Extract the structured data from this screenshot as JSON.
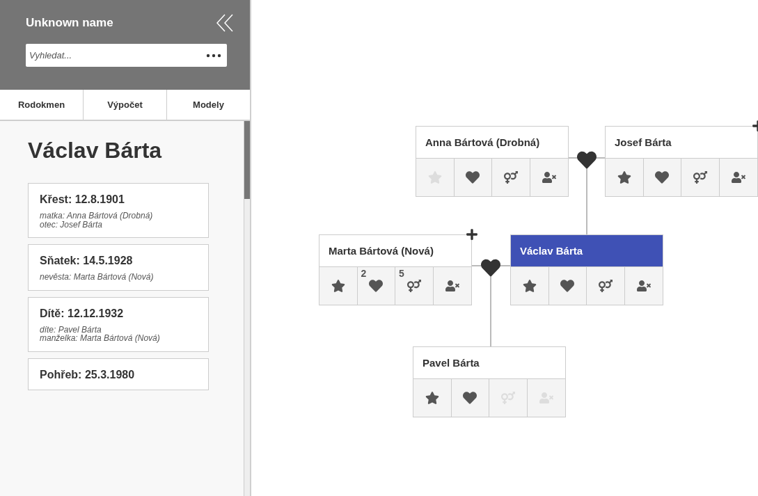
{
  "sidebar": {
    "title": "Unknown name",
    "search": {
      "placeholder": "Vyhledat..."
    },
    "tabs": [
      {
        "label": "Rodokmen",
        "selected": false
      },
      {
        "label": "Výpočet",
        "selected": false
      },
      {
        "label": "Modely",
        "selected": false
      }
    ],
    "person_name": "Václav Bárta",
    "events": [
      {
        "title": "Křest: 12.8.1901",
        "details": [
          "matka: Anna Bártová (Drobná)",
          "otec: Josef Bárta"
        ]
      },
      {
        "title": "Sňatek: 14.5.1928",
        "details": [
          "nevěsta: Marta Bártová (Nová)"
        ]
      },
      {
        "title": "Dítě: 12.12.1932",
        "details": [
          "díte: Pavel Bárta",
          "manželka: Marta Bártová (Nová)"
        ]
      },
      {
        "title": "Pohřeb: 25.3.1980"
      }
    ]
  },
  "tree": {
    "nodes": [
      {
        "name": "Anna Bártová (Drobná)",
        "selected": false,
        "add": false,
        "actions": [
          {
            "kind": "star",
            "disabled": true
          },
          {
            "kind": "heart",
            "disabled": false
          },
          {
            "kind": "gender",
            "disabled": false
          },
          {
            "kind": "remove",
            "disabled": false
          }
        ]
      },
      {
        "name": "Josef Bárta",
        "selected": false,
        "add": true,
        "actions": [
          {
            "kind": "star",
            "disabled": false
          },
          {
            "kind": "heart",
            "disabled": false
          },
          {
            "kind": "gender",
            "disabled": false
          },
          {
            "kind": "remove",
            "disabled": false
          }
        ]
      },
      {
        "name": "Marta Bártová (Nová)",
        "selected": false,
        "add": true,
        "actions": [
          {
            "kind": "star",
            "disabled": false
          },
          {
            "kind": "heart",
            "disabled": false,
            "count": "2"
          },
          {
            "kind": "gender",
            "disabled": false,
            "count": "5"
          },
          {
            "kind": "remove",
            "disabled": false
          }
        ]
      },
      {
        "name": "Václav Bárta",
        "selected": true,
        "add": false,
        "actions": [
          {
            "kind": "star",
            "disabled": false
          },
          {
            "kind": "heart",
            "disabled": false
          },
          {
            "kind": "gender",
            "disabled": false
          },
          {
            "kind": "remove",
            "disabled": false
          }
        ]
      },
      {
        "name": "Pavel Bárta",
        "selected": false,
        "add": false,
        "actions": [
          {
            "kind": "star",
            "disabled": false
          },
          {
            "kind": "heart",
            "disabled": false
          },
          {
            "kind": "gender",
            "disabled": true
          },
          {
            "kind": "remove",
            "disabled": true
          }
        ]
      }
    ]
  }
}
